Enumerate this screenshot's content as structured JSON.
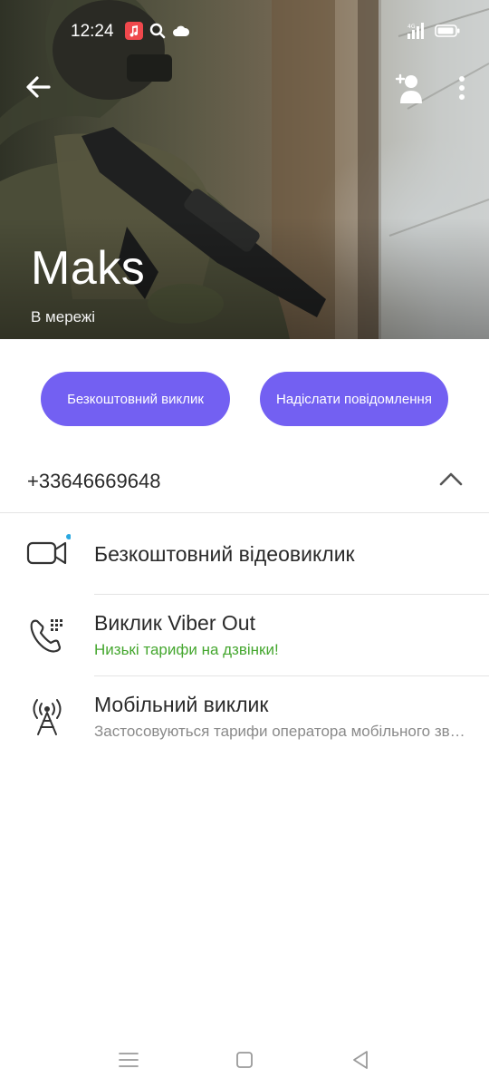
{
  "status_bar": {
    "time": "12:24",
    "icons": [
      "music-notification-icon",
      "search-icon",
      "cloud-icon",
      "signal-icon",
      "battery-icon"
    ]
  },
  "top_bar": {
    "back_icon": "arrow-left-icon",
    "add_contact_icon": "add-contact-icon",
    "more_icon": "more-vertical-icon"
  },
  "contact": {
    "name": "Maks",
    "status": "В мережі"
  },
  "actions": {
    "free_call_label": "Безкоштовний виклик",
    "send_message_label": "Надіслати повідомлення"
  },
  "phone": {
    "number": "+33646669648",
    "toggle_icon": "chevron-up-icon"
  },
  "options": [
    {
      "icon": "video-camera-icon",
      "title": "Безкоштовний відеовиклик",
      "subtitle": ""
    },
    {
      "icon": "viber-out-phone-icon",
      "title": "Виклик Viber Out",
      "subtitle": "Низькі тарифи на дзвінки!"
    },
    {
      "icon": "cell-tower-icon",
      "title": "Мобільний виклик",
      "subtitle": "Застосовуються тарифи оператора мобільного зв'язку"
    }
  ],
  "colors": {
    "accent": "#7360f2",
    "green_text": "#45a72f",
    "notification_dot": "#2aa8e0"
  },
  "nav_bar": {
    "icons": [
      "menu-icon",
      "home-icon",
      "back-icon"
    ]
  }
}
